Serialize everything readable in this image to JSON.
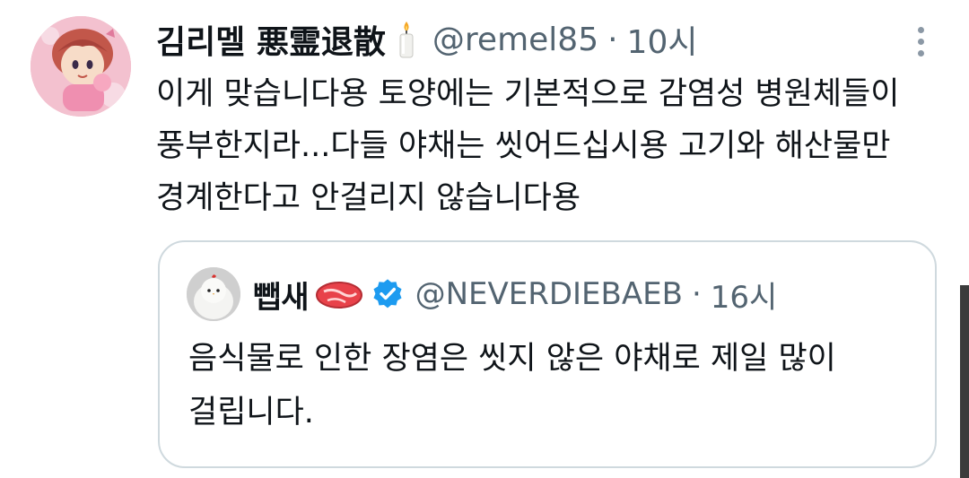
{
  "tweet": {
    "author_name": "김리멜 悪霊退散",
    "author_handle": "@remel85",
    "separator": "·",
    "time": "10시",
    "text_lines": [
      "이게 맞습니다용 토양에는 기본적으로 감염성 병원체들이",
      "풍부한지라...다들 야채는 씻어드십시용 고기와 해산물만",
      "경계한다고 안걸리지 않습니다용"
    ]
  },
  "quote": {
    "author_name": "뺍새",
    "author_handle": "@NEVERDIEBAEB",
    "separator": "·",
    "time": "16시",
    "text_lines": [
      "음식물로 인한 장염은 씻지 않은 야채로 제일 많이",
      "걸립니다."
    ]
  },
  "icons": {
    "avatar": "anime-girl-avatar",
    "candle": "candle-emoji",
    "more": "more-vertical-icon",
    "quote_avatar": "white-bird-avatar",
    "meat": "meat-emoji",
    "verified": "verified-badge-icon"
  },
  "colors": {
    "text": "#0f1419",
    "secondary": "#536471",
    "border": "#cfd9de",
    "verified": "#1d9bf0"
  }
}
